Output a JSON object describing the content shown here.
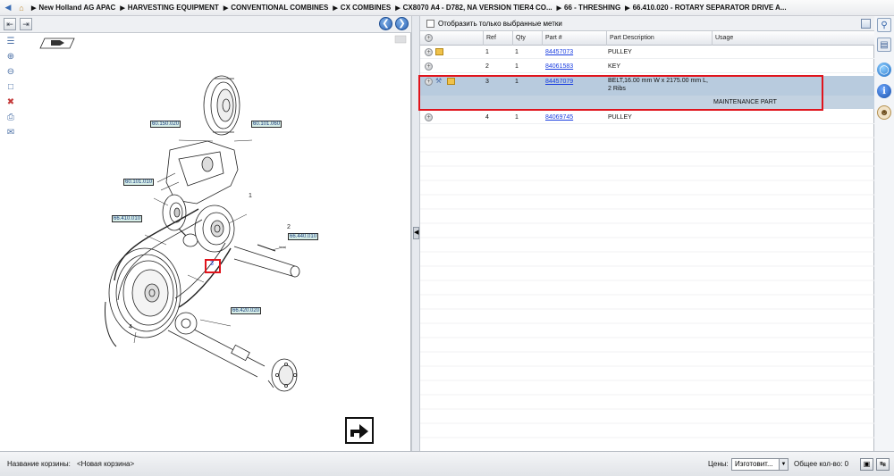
{
  "breadcrumb": {
    "items": [
      "New Holland AG APAC",
      "HARVESTING EQUIPMENT",
      "CONVENTIONAL COMBINES",
      "CX COMBINES",
      "CX8070 A4 - D782, NA VERSION TIER4 CO...",
      "66 - THRESHING",
      "66.410.020 - ROTARY SEPARATOR DRIVE A..."
    ]
  },
  "diagram": {
    "callouts": [
      "60.150.020",
      "60.101.060",
      "60.101.010",
      "66.410.010",
      "66.440.010",
      "66.420.020"
    ],
    "item_numbers": [
      "1",
      "2",
      "3",
      "4"
    ]
  },
  "parts": {
    "filter_label": "Отобразить только выбранные метки",
    "headers": {
      "ref": "Ref",
      "qty": "Qty",
      "part": "Part #",
      "desc": "Part Description",
      "usage": "Usage"
    },
    "rows": [
      {
        "ref": "1",
        "qty": "1",
        "part": "84457073",
        "desc": "PULLEY",
        "desc2": "",
        "usage": ""
      },
      {
        "ref": "2",
        "qty": "1",
        "part": "84061583",
        "desc": "KEY",
        "desc2": "",
        "usage": ""
      },
      {
        "ref": "3",
        "qty": "1",
        "part": "84457079",
        "desc": "BELT,16.00 mm W x 2175.00 mm L,",
        "desc2": "2 Ribs",
        "usage": "",
        "band": "MAINTENANCE PART"
      },
      {
        "ref": "4",
        "qty": "1",
        "part": "84069745",
        "desc": "PULLEY",
        "desc2": "",
        "usage": ""
      }
    ]
  },
  "status": {
    "basket_label": "Название корзины:",
    "basket_value": "<Новая корзина>",
    "prices_label": "Цены:",
    "prices_value": "Изготовит...",
    "total_label": "Общее кол-во: 0"
  },
  "icons": {
    "highlight_color": "#e0141c",
    "accent": "#2d64b4"
  }
}
